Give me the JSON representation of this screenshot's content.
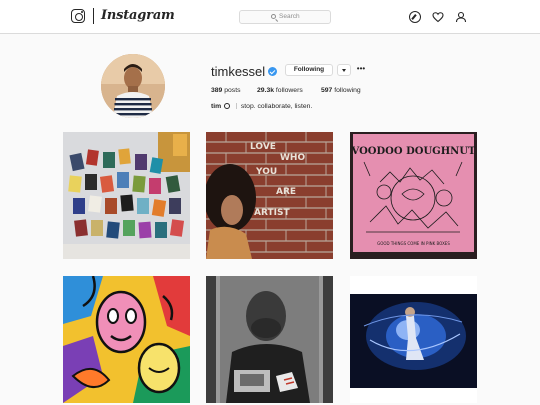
{
  "header": {
    "brand": "Instagram",
    "search_placeholder": "Search",
    "icons": [
      "instagram-camera-icon",
      "search-icon",
      "explore-compass-icon",
      "activity-heart-icon",
      "profile-person-icon"
    ]
  },
  "profile": {
    "username": "timkessel",
    "verified": true,
    "follow_button": "Following",
    "more": "•••",
    "stats": [
      {
        "value": "389",
        "label": "posts"
      },
      {
        "value": "29.3k",
        "label": "followers"
      },
      {
        "value": "597",
        "label": "following"
      }
    ],
    "bio_name": "tim",
    "bio_text": "stop. collaborate, listen."
  },
  "posts": [
    {
      "id": "books-on-bed"
    },
    {
      "id": "woman-brick-wall",
      "wall_text": "LOVE WHO YOU ARE ARTIST"
    },
    {
      "id": "voodoo-doughnut-box",
      "box_title": "VOODOO DOUGHNUT",
      "box_caption": "GOOD THINGS COME IN PINK BOXES"
    },
    {
      "id": "colorful-mural"
    },
    {
      "id": "bw-portrait-poster"
    },
    {
      "id": "blue-light-dancer"
    }
  ],
  "colors": {
    "verified": "#3897f0",
    "border": "#dbdbdb",
    "text": "#262626",
    "muted": "#8e8e8e",
    "background": "#fafafa"
  }
}
